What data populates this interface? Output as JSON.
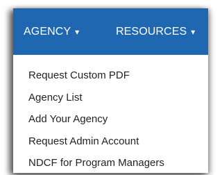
{
  "colors": {
    "navbar_bg": "#1f67b0",
    "navbar_text": "#ffffff",
    "menu_text": "#222222"
  },
  "navbar": {
    "items": [
      {
        "label": "AGENCY",
        "icon": "caret-down-icon",
        "caret": "▾"
      },
      {
        "label": "RESOURCES",
        "icon": "caret-down-icon",
        "caret": "▾"
      }
    ]
  },
  "dropdown": {
    "items": [
      {
        "label": "Request Custom PDF"
      },
      {
        "label": "Agency List"
      },
      {
        "label": "Add Your Agency"
      },
      {
        "label": "Request Admin Account"
      },
      {
        "label": "NDCF for Program Managers"
      }
    ]
  }
}
